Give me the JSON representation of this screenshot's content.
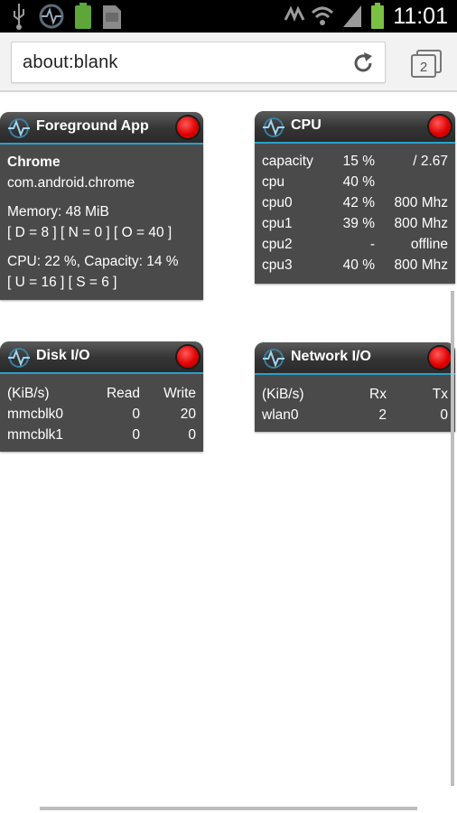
{
  "status_bar": {
    "time": "11:01",
    "left_icons": [
      "usb-icon",
      "sync-icon",
      "battery-app-icon",
      "sd-card-icon"
    ],
    "right_icons": [
      "signal-bars-icon",
      "wifi-icon",
      "cell-signal-icon",
      "battery-icon"
    ]
  },
  "browser": {
    "url": "about:blank",
    "tab_count": "2"
  },
  "widgets": {
    "foreground": {
      "title": "Foreground App",
      "app_name": "Chrome",
      "package": "com.android.chrome",
      "memory": "Memory: 48 MiB",
      "dno": "[ D = 8 ] [ N = 0 ] [ O = 40 ]",
      "cpu": "CPU: 22 %, Capacity: 14 %",
      "us": "[ U = 16 ] [ S = 6 ]"
    },
    "cpu": {
      "title": "CPU",
      "rows": [
        {
          "name": "capacity",
          "pct": "15 %",
          "val": "/ 2.67"
        },
        {
          "name": "cpu",
          "pct": "40 %",
          "val": ""
        },
        {
          "name": "cpu0",
          "pct": "42 %",
          "val": "800 Mhz"
        },
        {
          "name": "cpu1",
          "pct": "39 %",
          "val": "800 Mhz"
        },
        {
          "name": "cpu2",
          "pct": "-",
          "val": "offline"
        },
        {
          "name": "cpu3",
          "pct": "40 %",
          "val": "800 Mhz"
        }
      ]
    },
    "disk": {
      "title": "Disk I/O",
      "header": {
        "unit": "(KiB/s)",
        "read": "Read",
        "write": "Write"
      },
      "rows": [
        {
          "dev": "mmcblk0",
          "read": "0",
          "write": "20"
        },
        {
          "dev": "mmcblk1",
          "read": "0",
          "write": "0"
        }
      ]
    },
    "network": {
      "title": "Network I/O",
      "header": {
        "unit": "(KiB/s)",
        "rx": "Rx",
        "tx": "Tx"
      },
      "rows": [
        {
          "iface": "wlan0",
          "rx": "2",
          "tx": "0"
        }
      ]
    }
  },
  "colors": {
    "accent": "#2aa0c8",
    "widget_bg": "#4a4a4a",
    "status_dot": "#e00000"
  }
}
